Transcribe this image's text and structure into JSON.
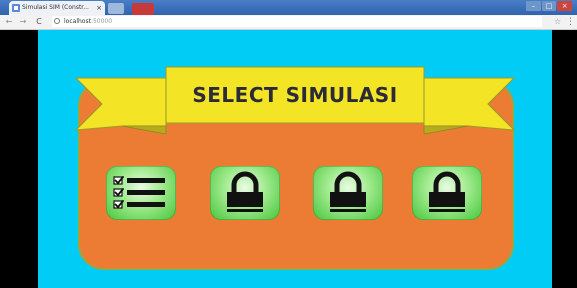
{
  "browser": {
    "tab_title": "Simulasi SIM (Constr...",
    "tab_close": "×",
    "url_host": "localhost",
    "url_port": ":50000",
    "back": "←",
    "forward": "→",
    "reload": "C",
    "star": "☆",
    "menu": "⋮",
    "window_controls": [
      "–",
      "□",
      "×"
    ]
  },
  "game": {
    "banner_title": "SELECT SIMULASI",
    "colors": {
      "background": "#00ccf5",
      "panel": "#ec7c34",
      "ribbon": "#f4e426",
      "tile_green": "#46c43a"
    },
    "levels": [
      {
        "icon": "checklist-icon",
        "locked": false
      },
      {
        "icon": "lock-icon",
        "locked": true
      },
      {
        "icon": "lock-icon",
        "locked": true
      },
      {
        "icon": "lock-icon",
        "locked": true
      }
    ]
  }
}
